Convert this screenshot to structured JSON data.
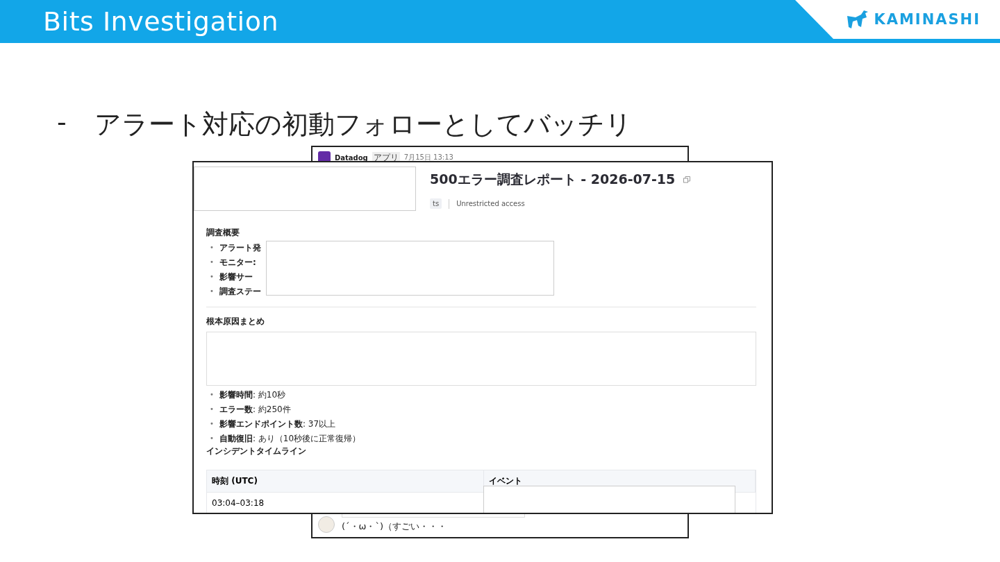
{
  "slide": {
    "title": "Bits Investigation",
    "logo": "KAMINASHI",
    "bullets": [
      {
        "marker": "-",
        "text": "アラート対応の初動フォローとしてバッチリ"
      }
    ]
  },
  "chat_screenshot": {
    "sender": "Datadog",
    "badge": "アプリ",
    "time": "7月15日 13:13",
    "reply": "(´・ω・`)（すごい・・・"
  },
  "report_screenshot": {
    "title": "500エラー調査レポート - 2026-07-15",
    "tag": "ts",
    "access": "Unrestricted access",
    "overview": {
      "heading": "調査概要",
      "items": [
        {
          "marker": "•",
          "label": "アラート発"
        },
        {
          "marker": "•",
          "label": "モニター:"
        },
        {
          "marker": "•",
          "label": "影響サー"
        },
        {
          "marker": "•",
          "label": "調査ステー"
        }
      ]
    },
    "root_cause": {
      "heading": "根本原因まとめ",
      "items": [
        {
          "marker": "•",
          "label": "影響時間",
          "value": ": 約10秒"
        },
        {
          "marker": "•",
          "label": "エラー数",
          "value": ": 約250件"
        },
        {
          "marker": "•",
          "label": "影響エンドポイント数",
          "value": ": 37以上"
        },
        {
          "marker": "•",
          "label": "自動復旧",
          "value": ": あり（10秒後に正常復帰）"
        }
      ]
    },
    "timeline": {
      "heading": "インシデントタイムライン",
      "columns": [
        "時刻 (UTC)",
        "イベント"
      ],
      "rows": [
        [
          "03:04–03:18"
        ]
      ]
    }
  }
}
